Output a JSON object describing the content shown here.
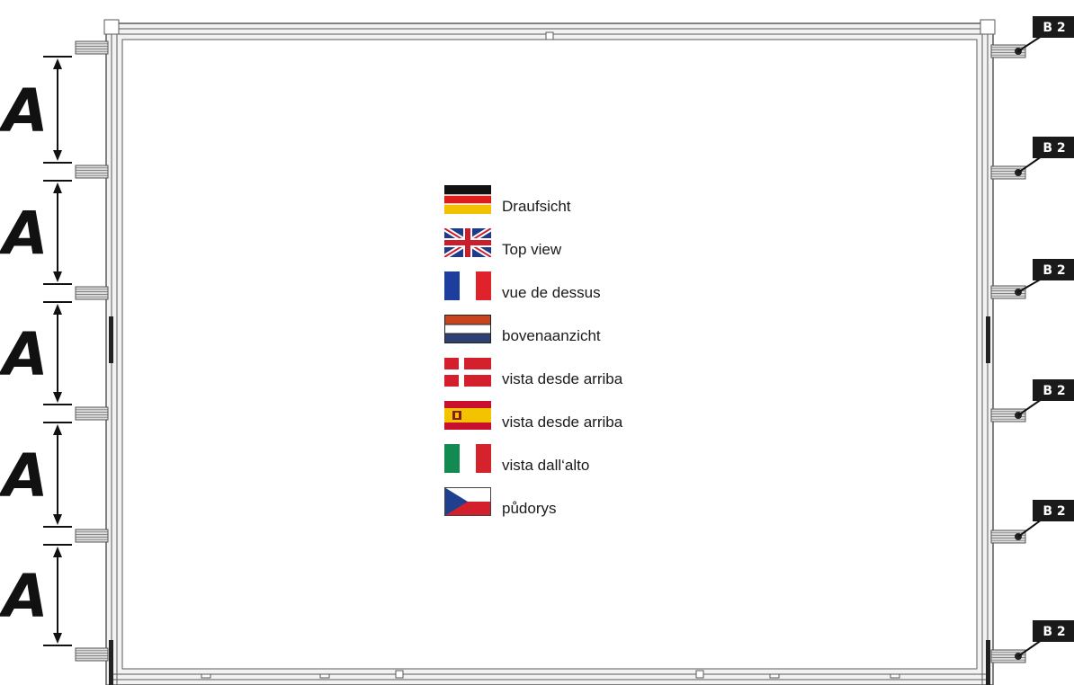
{
  "legend": {
    "items": [
      {
        "flag": "germany-flag-icon",
        "label": "Draufsicht"
      },
      {
        "flag": "uk-flag-icon",
        "label": "Top view"
      },
      {
        "flag": "france-flag-icon",
        "label": "vue de dessus"
      },
      {
        "flag": "netherlands-flag-icon",
        "label": "bovenaanzicht"
      },
      {
        "flag": "denmark-flag-icon",
        "label": "vista desde arriba"
      },
      {
        "flag": "spain-flag-icon",
        "label": "vista desde arriba"
      },
      {
        "flag": "italy-flag-icon",
        "label": "vista dall‘alto"
      },
      {
        "flag": "czech-flag-icon",
        "label": "půdorys"
      }
    ]
  },
  "dimensions": {
    "spacing_label": "A",
    "count": 5
  },
  "connectors": {
    "label": "B 2",
    "count": 6
  },
  "colors": {
    "frame": "#5a5a5a",
    "frame_fill": "#e6e6e6",
    "tag": "#1a1a1a",
    "tag_text": "#ffffff"
  }
}
